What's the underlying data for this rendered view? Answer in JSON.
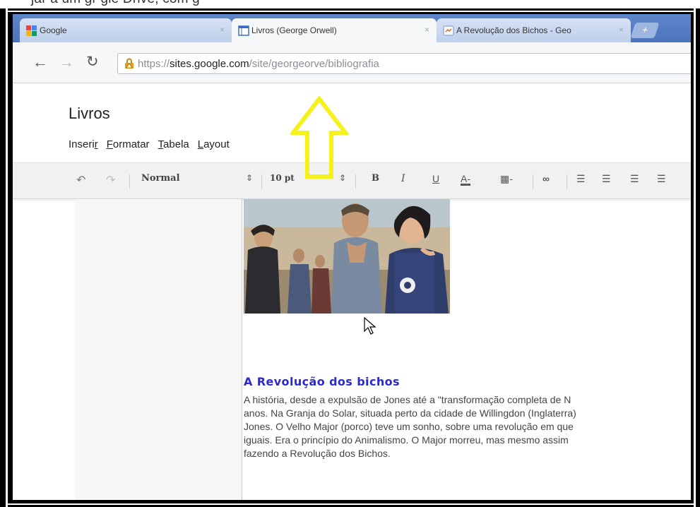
{
  "caption_fragment": "jar a um gr gle Drive, com g",
  "tabs": [
    {
      "label": "Google",
      "state": "inactive",
      "icon": "google-favicon"
    },
    {
      "label": "Livros (George Orwell)",
      "state": "active",
      "icon": "google-sites-favicon"
    },
    {
      "label": "A Revolução dos Bichos - Geo",
      "state": "inactive",
      "icon": "blogger-favicon"
    }
  ],
  "tab_close": "×",
  "url": {
    "scheme": "https://",
    "host": "sites.google.com",
    "path": "/site/georgeorve/bibliografia"
  },
  "site": {
    "title": "Livros"
  },
  "menus": [
    {
      "label": "Inserir",
      "underline": "r"
    },
    {
      "label": "Formatar",
      "underline": "F"
    },
    {
      "label": "Tabela",
      "underline": "T"
    },
    {
      "label": "Layout",
      "underline": "L"
    }
  ],
  "format_bar": {
    "style": "Normal",
    "size": "10 pt",
    "bold": "B",
    "italic": "I",
    "underline": "U",
    "text_color": "A",
    "link_icon": "link-icon"
  },
  "article": {
    "heading": "A Revolução dos bichos",
    "lines": [
      "A história, desde a expulsão de Jones até a \"transformação completa de N",
      "anos. Na Granja do Solar, situada perto da cidade de Willingdon (Inglaterra)",
      "Jones. O Velho Major (porco) teve um sonho, sobre uma revolução em que",
      "iguais. Era o princípio do Animalismo. O Major morreu, mas mesmo assim",
      "fazendo a Revolução dos Bichos."
    ]
  },
  "colors": {
    "arrow": "#f4f21a",
    "heading": "#2a2ad0",
    "tabstrip": "#4b74bd"
  }
}
